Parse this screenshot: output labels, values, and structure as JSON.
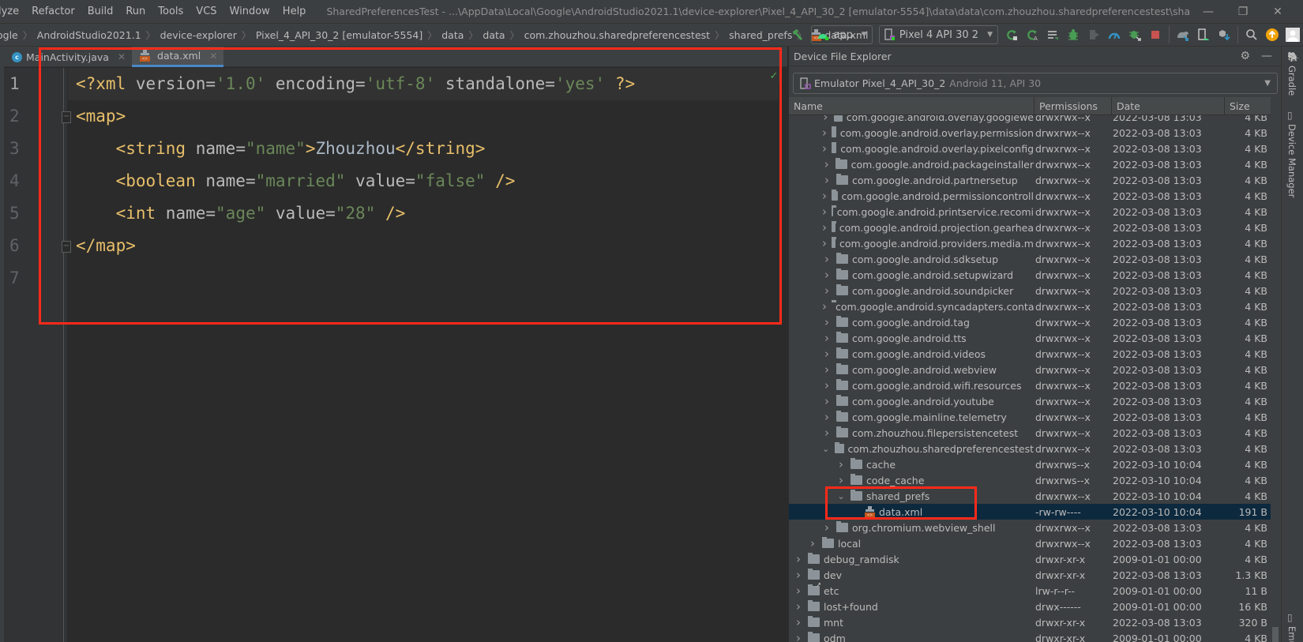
{
  "menu": {
    "items": [
      "lyze",
      "Refactor",
      "Build",
      "Run",
      "Tools",
      "VCS",
      "Window",
      "Help"
    ],
    "window_title": "SharedPreferencesTest - ...\\AppData\\Local\\Google\\AndroidStudio2021.1\\device-explorer\\Pixel_4_API_30_2 [emulator-5554]\\data\\data\\com.zhouzhou.sharedpreferencestest\\shared_prefs\\data.xml",
    "controls": {
      "minimize": "—",
      "restore": "❐",
      "close": "✕"
    }
  },
  "breadcrumb": [
    "ogle",
    "AndroidStudio2021.1",
    "device-explorer",
    "Pixel_4_API_30_2 [emulator-5554]",
    "data",
    "data",
    "com.zhouzhou.sharedpreferencestest",
    "shared_prefs",
    "data.xml"
  ],
  "toolbar": {
    "run_config": "app",
    "device": "Pixel 4 API 30 2",
    "icons": [
      "hammer-icon",
      "run-config-icon",
      "device-icon",
      "apply-changes-icon",
      "apply-code-changes-icon",
      "logcat-icon",
      "debug-icon",
      "attach-icon",
      "profile-icon",
      "attach-debugger-icon",
      "stop-icon",
      "sync-gradle-icon",
      "avd-manager-icon",
      "sdk-manager-icon",
      "search-icon",
      "update-icon",
      "account-icon"
    ]
  },
  "tabs": [
    {
      "label": "MainActivity.java",
      "icon": "java-class-icon",
      "active": false
    },
    {
      "label": "data.xml",
      "icon": "xml-file-icon",
      "active": true
    }
  ],
  "editor": {
    "line_numbers": [
      "1",
      "2",
      "3",
      "4",
      "5",
      "6",
      "7"
    ],
    "current_line": 1,
    "lines": [
      "<?xml version='1.0' encoding='utf-8' standalone='yes' ?>",
      "<map>",
      "    <string name=\"name\">Zhouzhou</string>",
      "    <boolean name=\"married\" value=\"false\" />",
      "    <int name=\"age\" value=\"28\" />",
      "</map>",
      ""
    ],
    "tokens": {
      "l1": [
        "<?xml ",
        "version",
        "=",
        "'1.0'",
        " encoding",
        "=",
        "'utf-8'",
        " standalone",
        "=",
        "'yes'",
        " ?>"
      ],
      "l2": [
        "<map>"
      ],
      "l3": [
        "    ",
        "<string ",
        "name",
        "=",
        "\"name\"",
        ">",
        "Zhouzhou",
        "</string>"
      ],
      "l4": [
        "    ",
        "<boolean ",
        "name",
        "=",
        "\"married\"",
        " value",
        "=",
        "\"false\"",
        " />"
      ],
      "l5": [
        "    ",
        "<int ",
        "name",
        "=",
        "\"age\"",
        " value",
        "=",
        "\"28\"",
        " />"
      ],
      "l6": [
        "</map>"
      ]
    },
    "inspection_status": "✓"
  },
  "explorer": {
    "title": "Device File Explorer",
    "device_name": "Emulator Pixel_4_API_30_2",
    "device_info": "Android 11, API 30",
    "columns": [
      "Name",
      "Permissions",
      "Date",
      "Size"
    ],
    "rows": [
      {
        "name": "com.google.android.overlay.googlewe",
        "perm": "drwxrwx--x",
        "date": "2022-03-08 13:03",
        "size": "4 KB",
        "level": 2,
        "expanded": false,
        "type": "folder"
      },
      {
        "name": "com.google.android.overlay.permission",
        "perm": "drwxrwx--x",
        "date": "2022-03-08 13:03",
        "size": "4 KB",
        "level": 2,
        "expanded": false,
        "type": "folder"
      },
      {
        "name": "com.google.android.overlay.pixelconfig",
        "perm": "drwxrwx--x",
        "date": "2022-03-08 13:03",
        "size": "4 KB",
        "level": 2,
        "expanded": false,
        "type": "folder"
      },
      {
        "name": "com.google.android.packageinstaller",
        "perm": "drwxrwx--x",
        "date": "2022-03-08 13:03",
        "size": "4 KB",
        "level": 2,
        "expanded": false,
        "type": "folder"
      },
      {
        "name": "com.google.android.partnersetup",
        "perm": "drwxrwx--x",
        "date": "2022-03-08 13:03",
        "size": "4 KB",
        "level": 2,
        "expanded": false,
        "type": "folder"
      },
      {
        "name": "com.google.android.permissioncontroll",
        "perm": "drwxrwx--x",
        "date": "2022-03-08 13:03",
        "size": "4 KB",
        "level": 2,
        "expanded": false,
        "type": "folder"
      },
      {
        "name": "com.google.android.printservice.recomi",
        "perm": "drwxrwx--x",
        "date": "2022-03-08 13:03",
        "size": "4 KB",
        "level": 2,
        "expanded": false,
        "type": "folder"
      },
      {
        "name": "com.google.android.projection.gearhea",
        "perm": "drwxrwx--x",
        "date": "2022-03-08 13:03",
        "size": "4 KB",
        "level": 2,
        "expanded": false,
        "type": "folder"
      },
      {
        "name": "com.google.android.providers.media.m",
        "perm": "drwxrwx--x",
        "date": "2022-03-08 13:03",
        "size": "4 KB",
        "level": 2,
        "expanded": false,
        "type": "folder"
      },
      {
        "name": "com.google.android.sdksetup",
        "perm": "drwxrwx--x",
        "date": "2022-03-08 13:03",
        "size": "4 KB",
        "level": 2,
        "expanded": false,
        "type": "folder"
      },
      {
        "name": "com.google.android.setupwizard",
        "perm": "drwxrwx--x",
        "date": "2022-03-08 13:03",
        "size": "4 KB",
        "level": 2,
        "expanded": false,
        "type": "folder"
      },
      {
        "name": "com.google.android.soundpicker",
        "perm": "drwxrwx--x",
        "date": "2022-03-08 13:03",
        "size": "4 KB",
        "level": 2,
        "expanded": false,
        "type": "folder"
      },
      {
        "name": "com.google.android.syncadapters.conta",
        "perm": "drwxrwx--x",
        "date": "2022-03-08 13:03",
        "size": "4 KB",
        "level": 2,
        "expanded": false,
        "type": "folder"
      },
      {
        "name": "com.google.android.tag",
        "perm": "drwxrwx--x",
        "date": "2022-03-08 13:03",
        "size": "4 KB",
        "level": 2,
        "expanded": false,
        "type": "folder"
      },
      {
        "name": "com.google.android.tts",
        "perm": "drwxrwx--x",
        "date": "2022-03-08 13:03",
        "size": "4 KB",
        "level": 2,
        "expanded": false,
        "type": "folder"
      },
      {
        "name": "com.google.android.videos",
        "perm": "drwxrwx--x",
        "date": "2022-03-08 13:03",
        "size": "4 KB",
        "level": 2,
        "expanded": false,
        "type": "folder"
      },
      {
        "name": "com.google.android.webview",
        "perm": "drwxrwx--x",
        "date": "2022-03-08 13:03",
        "size": "4 KB",
        "level": 2,
        "expanded": false,
        "type": "folder"
      },
      {
        "name": "com.google.android.wifi.resources",
        "perm": "drwxrwx--x",
        "date": "2022-03-08 13:03",
        "size": "4 KB",
        "level": 2,
        "expanded": false,
        "type": "folder"
      },
      {
        "name": "com.google.android.youtube",
        "perm": "drwxrwx--x",
        "date": "2022-03-08 13:03",
        "size": "4 KB",
        "level": 2,
        "expanded": false,
        "type": "folder"
      },
      {
        "name": "com.google.mainline.telemetry",
        "perm": "drwxrwx--x",
        "date": "2022-03-08 13:03",
        "size": "4 KB",
        "level": 2,
        "expanded": false,
        "type": "folder"
      },
      {
        "name": "com.zhouzhou.filepersistencetest",
        "perm": "drwxrwx--x",
        "date": "2022-03-08 13:03",
        "size": "4 KB",
        "level": 2,
        "expanded": false,
        "type": "folder"
      },
      {
        "name": "com.zhouzhou.sharedpreferencestest",
        "perm": "drwxrwx--x",
        "date": "2022-03-08 13:03",
        "size": "4 KB",
        "level": 2,
        "expanded": true,
        "type": "folder"
      },
      {
        "name": "cache",
        "perm": "drwxrws--x",
        "date": "2022-03-10 10:04",
        "size": "4 KB",
        "level": 3,
        "expanded": false,
        "type": "folder"
      },
      {
        "name": "code_cache",
        "perm": "drwxrws--x",
        "date": "2022-03-10 10:04",
        "size": "4 KB",
        "level": 3,
        "expanded": false,
        "type": "folder"
      },
      {
        "name": "shared_prefs",
        "perm": "drwxrwx--x",
        "date": "2022-03-10 10:04",
        "size": "4 KB",
        "level": 3,
        "expanded": true,
        "type": "folder"
      },
      {
        "name": "data.xml",
        "perm": "-rw-rw----",
        "date": "2022-03-10 10:04",
        "size": "191 B",
        "level": 4,
        "expanded": false,
        "type": "xml",
        "selected": true
      },
      {
        "name": "org.chromium.webview_shell",
        "perm": "drwxrwx--x",
        "date": "2022-03-08 13:03",
        "size": "4 KB",
        "level": 2,
        "expanded": false,
        "type": "folder"
      },
      {
        "name": "local",
        "perm": "drwxrwx--x",
        "date": "2022-03-08 13:03",
        "size": "4 KB",
        "level": 1,
        "expanded": false,
        "type": "folder"
      },
      {
        "name": "debug_ramdisk",
        "perm": "drwxr-xr-x",
        "date": "2009-01-01 00:00",
        "size": "4 KB",
        "level": 0,
        "expanded": false,
        "type": "folder"
      },
      {
        "name": "dev",
        "perm": "drwxr-xr-x",
        "date": "2022-03-08 13:03",
        "size": "1.3 KB",
        "level": 0,
        "expanded": false,
        "type": "folder"
      },
      {
        "name": "etc",
        "perm": "lrw-r--r--",
        "date": "2009-01-01 00:00",
        "size": "11 B",
        "level": 0,
        "expanded": false,
        "type": "link"
      },
      {
        "name": "lost+found",
        "perm": "drwx------",
        "date": "2009-01-01 00:00",
        "size": "16 KB",
        "level": 0,
        "expanded": false,
        "type": "folder"
      },
      {
        "name": "mnt",
        "perm": "drwxr-xr-x",
        "date": "2022-03-08 13:03",
        "size": "320 B",
        "level": 0,
        "expanded": false,
        "type": "folder"
      },
      {
        "name": "odm",
        "perm": "drwxr-xr-x",
        "date": "2009-01-01 00:00",
        "size": "4 KB",
        "level": 0,
        "expanded": false,
        "type": "folder"
      }
    ]
  },
  "right_sidebar": {
    "items": [
      {
        "label": "Gradle",
        "icon": "gradle-icon"
      },
      {
        "label": "Device Manager",
        "icon": "device-manager-icon"
      },
      {
        "label": "Emu",
        "icon": "emulator-icon"
      }
    ]
  },
  "colors": {
    "highlight_box": "#ff2a1a",
    "selection": "#0d293e",
    "xml_tag": "#e8bf6a",
    "xml_value": "#6a8759",
    "accent_tab": "#4a88c7"
  }
}
